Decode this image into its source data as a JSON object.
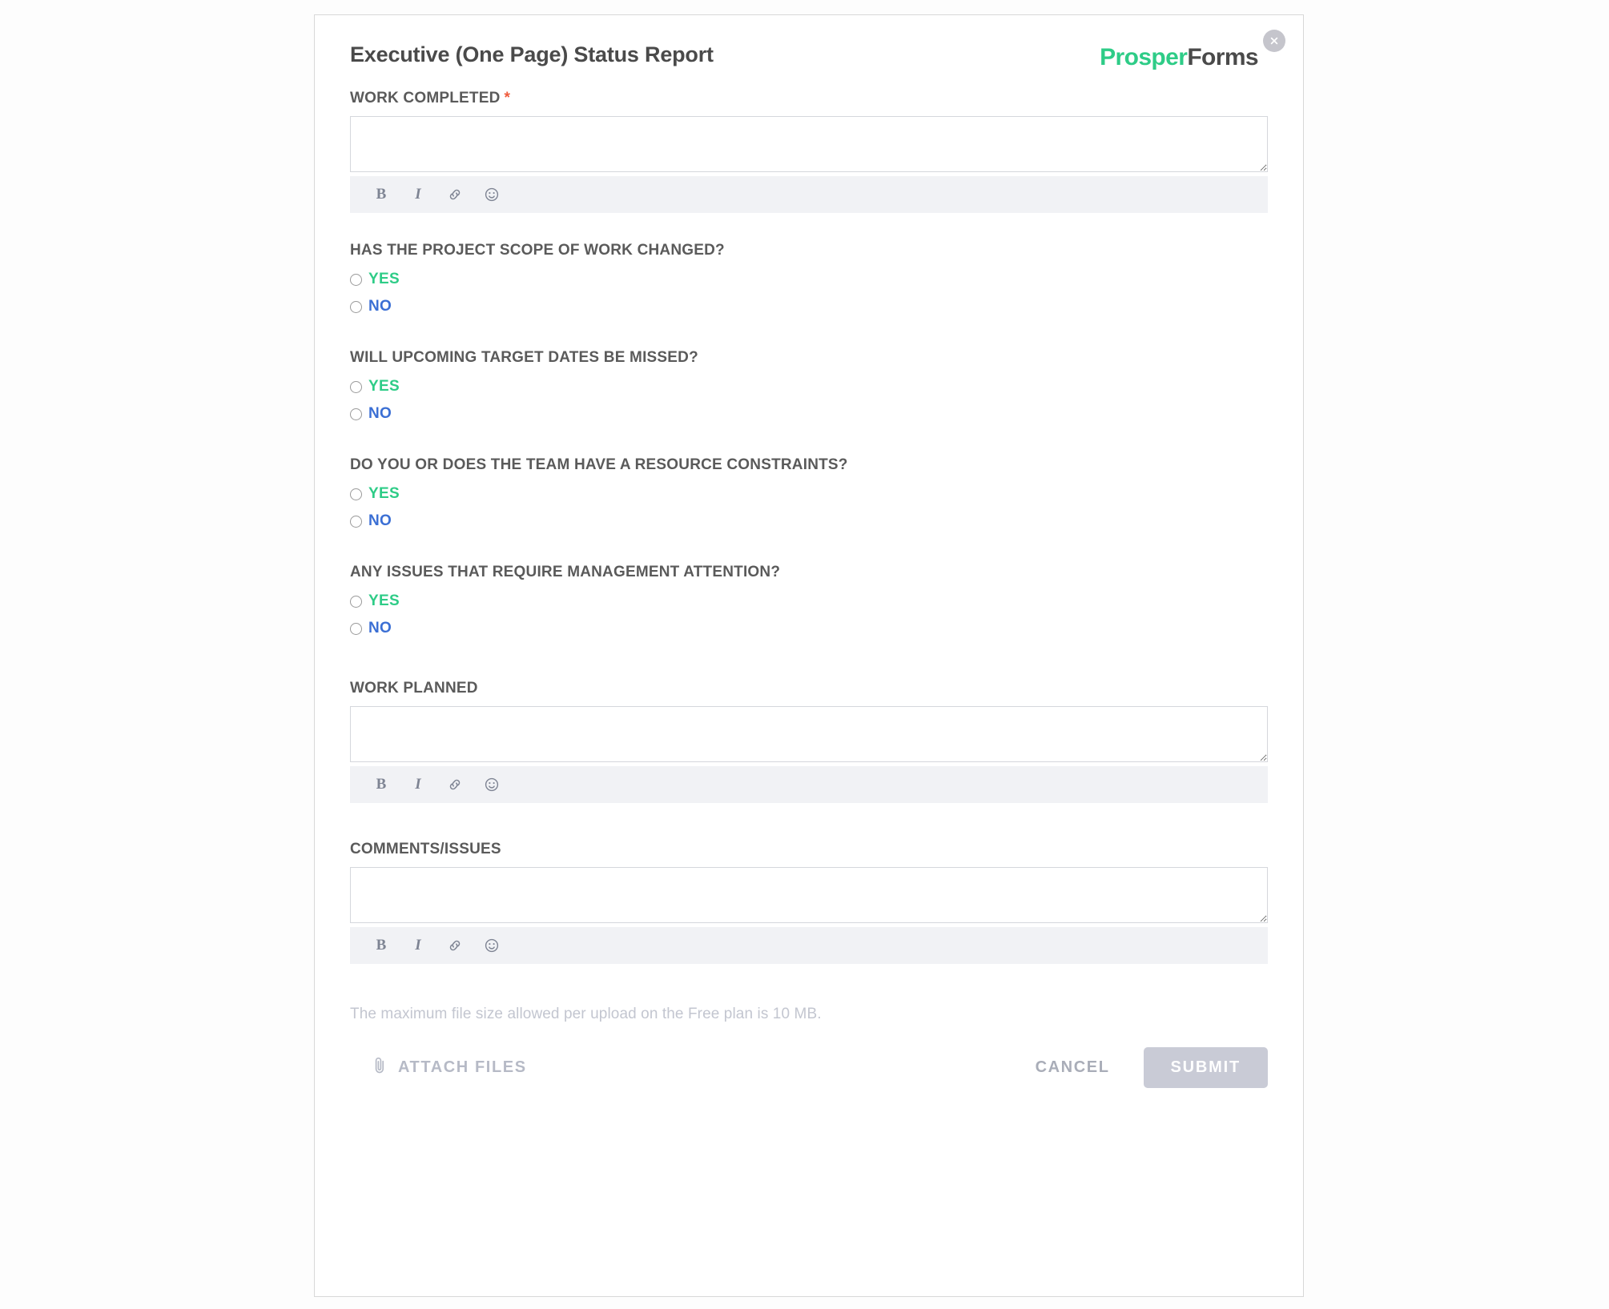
{
  "form": {
    "title": "Executive (One Page) Status Report",
    "brand": {
      "part1": "Prosper",
      "part2": "Forms",
      "color_primary": "#2ecc87",
      "color_secondary": "#4a4a4a"
    },
    "close_label": "×"
  },
  "fields": {
    "work_completed": {
      "label": "WORK COMPLETED",
      "required_marker": "*",
      "value": "",
      "placeholder": ""
    },
    "work_planned": {
      "label": "WORK PLANNED",
      "value": "",
      "placeholder": ""
    },
    "comments_issues": {
      "label": "COMMENTS/ISSUES",
      "value": "",
      "placeholder": ""
    }
  },
  "editor_toolbar": {
    "bold": "B",
    "italic": "I",
    "link_icon": "link-icon",
    "emoji_icon": "emoji-icon"
  },
  "questions": [
    {
      "title": "HAS THE PROJECT SCOPE OF WORK CHANGED?",
      "options": [
        {
          "label": "YES",
          "color": "#2ecc87",
          "selected": false
        },
        {
          "label": "NO",
          "color": "#3b6fd4",
          "selected": false
        }
      ]
    },
    {
      "title": "WILL UPCOMING TARGET DATES BE MISSED?",
      "options": [
        {
          "label": "YES",
          "color": "#2ecc87",
          "selected": false
        },
        {
          "label": "NO",
          "color": "#3b6fd4",
          "selected": false
        }
      ]
    },
    {
      "title": "DO YOU OR DOES THE TEAM HAVE A RESOURCE CONSTRAINTS?",
      "options": [
        {
          "label": "YES",
          "color": "#2ecc87",
          "selected": false
        },
        {
          "label": "NO",
          "color": "#3b6fd4",
          "selected": false
        }
      ]
    },
    {
      "title": "ANY ISSUES THAT REQUIRE MANAGEMENT ATTENTION?",
      "options": [
        {
          "label": "YES",
          "color": "#2ecc87",
          "selected": false
        },
        {
          "label": "NO",
          "color": "#3b6fd4",
          "selected": false
        }
      ]
    }
  ],
  "footer": {
    "file_note": "The maximum file size allowed per upload on the Free plan is 10 MB.",
    "attach_label": "ATTACH FILES",
    "cancel_label": "CANCEL",
    "submit_label": "SUBMIT",
    "submit_disabled": true
  }
}
